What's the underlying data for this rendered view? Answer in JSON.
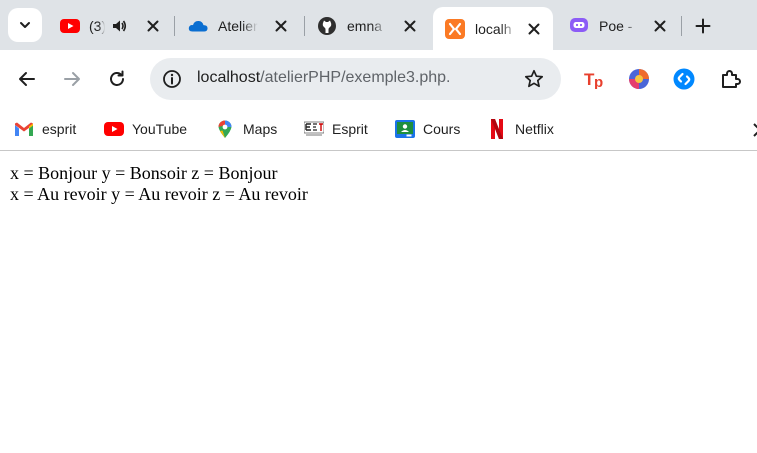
{
  "tabs": [
    {
      "title": "(3)",
      "favicon": "youtube-icon",
      "audio": "speaker-icon"
    },
    {
      "title": "Atelier",
      "favicon": "onedrive-cloud-icon"
    },
    {
      "title": "emna",
      "favicon": "github-icon"
    },
    {
      "title": "localh",
      "favicon": "xampp-icon",
      "active": true
    },
    {
      "title": "Poe -",
      "favicon": "poe-icon"
    }
  ],
  "tab_actions": {
    "new_tab": "+",
    "search_tabs": "chevron-down-icon"
  },
  "omnibox": {
    "host": "localhost",
    "path": "/atelierPHP/exemple3.php."
  },
  "extensions": [
    {
      "name": "tp-extension-icon",
      "label": "Tp"
    },
    {
      "name": "colorful-extension-icon"
    },
    {
      "name": "shazam-icon"
    },
    {
      "name": "extensions-puzzle-icon"
    }
  ],
  "bookmarks": [
    {
      "label": "esprit",
      "icon": "gmail-icon"
    },
    {
      "label": "YouTube",
      "icon": "youtube-icon"
    },
    {
      "label": "Maps",
      "icon": "maps-pin-icon"
    },
    {
      "label": "Esprit",
      "icon": "esprit-logo-icon"
    },
    {
      "label": "Cours",
      "icon": "classroom-icon"
    },
    {
      "label": "Netflix",
      "icon": "netflix-icon"
    }
  ],
  "content": {
    "line1": "x = Bonjour y = Bonsoir z = Bonjour",
    "line2": "x = Au revoir y = Au revoir z = Au revoir"
  },
  "colors": {
    "tabstrip_bg": "#dfe3e7",
    "omnibox_bg": "#e9ecef",
    "youtube_red": "#ff0000",
    "xampp_orange": "#fb7a24",
    "shazam_blue": "#0088ff"
  }
}
